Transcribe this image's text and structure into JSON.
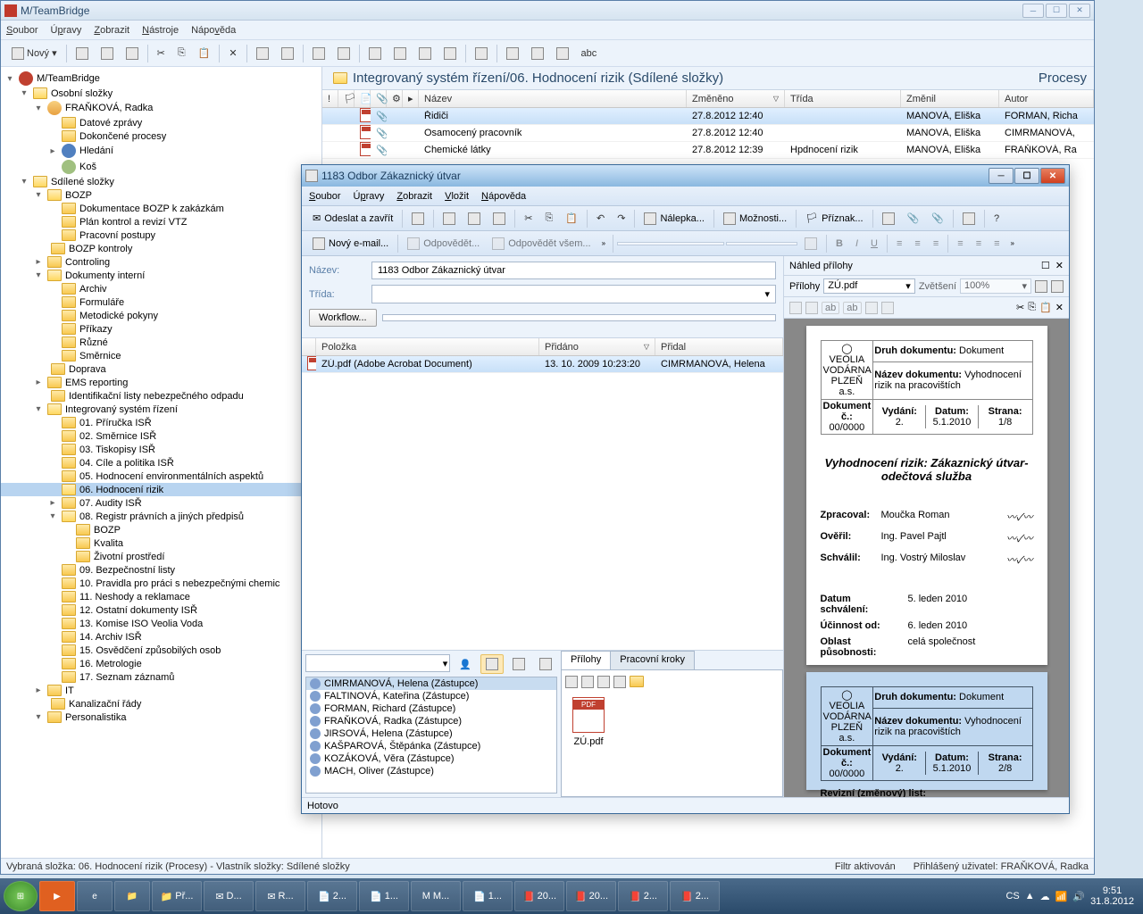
{
  "app": {
    "title": "M/TeamBridge"
  },
  "menubar": [
    "Soubor",
    "Úpravy",
    "Zobrazit",
    "Nástroje",
    "Nápověda"
  ],
  "toolbar": {
    "novy": "Nový"
  },
  "tree": {
    "root": "M/TeamBridge",
    "osobni": "Osobní složky",
    "user": "FRAŇKOVÁ, Radka",
    "datove": "Datové zprávy",
    "dokoncene": "Dokončené procesy",
    "hledani": "Hledání",
    "kos": "Koš",
    "sdilene": "Sdílené složky",
    "bozp": "BOZP",
    "dok_bozp": "Dokumentace BOZP k zakázkám",
    "plan": "Plán kontrol a revizí VTZ",
    "prac_postupy": "Pracovní postupy",
    "bozp_kontroly": "BOZP kontroly",
    "controling": "Controling",
    "dok_interni": "Dokumenty interní",
    "archiv": "Archiv",
    "formulare": "Formuláře",
    "metodicke": "Metodické pokyny",
    "prikazy": "Příkazy",
    "ruzne": "Různé",
    "smernice": "Směrnice",
    "doprava": "Doprava",
    "ems": "EMS reporting",
    "ident_listy": "Identifikační listy nebezpečného odpadu",
    "isr": "Integrovaný systém řízení",
    "i01": "01. Příručka ISŘ",
    "i02": "02. Směrnice ISŘ",
    "i03": "03. Tiskopisy ISŘ",
    "i04": "04. Cíle a politika ISŘ",
    "i05": "05. Hodnocení environmentálních aspektů",
    "i06": "06. Hodnocení rizik",
    "i07": "07. Audity ISŘ",
    "i08": "08. Registr právních a jiných předpisů",
    "i08_bozp": "BOZP",
    "i08_kvalita": "Kvalita",
    "i08_zivotni": "Životní prostředí",
    "i09": "09. Bezpečnostní listy",
    "i10": "10. Pravidla pro práci s nebezpečnými chemic",
    "i11": "11. Neshody a reklamace",
    "i12": "12. Ostatní dokumenty ISŘ",
    "i13": "13. Komise ISO Veolia Voda",
    "i14": "14. Archiv ISŘ",
    "i15": "15. Osvědčení způsobilých osob",
    "i16": "16. Metrologie",
    "i17": "17. Seznam záznamů",
    "it": "IT",
    "kanal": "Kanalizační řády",
    "personal": "Personalistika"
  },
  "breadcrumb": {
    "path": "Integrovaný systém řízení/06. Hodnocení rizik (Sdílené složky)",
    "right": "Procesy"
  },
  "grid": {
    "cols": {
      "nazev": "Název",
      "zmeneno": "Změněno",
      "trida": "Třída",
      "zmenil": "Změnil",
      "autor": "Autor"
    },
    "rows": [
      {
        "nazev": "Řidiči",
        "zmeneno": "27.8.2012 12:40",
        "trida": "",
        "zmenil": "MANOVÁ, Eliška",
        "autor": "FORMAN, Richa"
      },
      {
        "nazev": "Osamocený pracovník",
        "zmeneno": "27.8.2012 12:40",
        "trida": "",
        "zmenil": "MANOVÁ, Eliška",
        "autor": "CIMRMANOVÁ,"
      },
      {
        "nazev": "Chemické látky",
        "zmeneno": "27.8.2012 12:39",
        "trida": "Hpdnocení rizik",
        "zmenil": "MANOVÁ, Eliška",
        "autor": "FRAŇKOVÁ, Ra"
      }
    ]
  },
  "inner": {
    "title": "1183 Odbor Zákaznický útvar",
    "menubar": [
      "Soubor",
      "Úpravy",
      "Zobrazit",
      "Vložit",
      "Nápověda"
    ],
    "tb": {
      "odeslat": "Odeslat a zavřít",
      "nalepka": "Nálepka...",
      "moznosti": "Možnosti...",
      "priznak": "Příznak..."
    },
    "tb2": {
      "novy_email": "Nový e-mail...",
      "odpovedet": "Odpovědět...",
      "odpovedet_vsem": "Odpovědět všem..."
    },
    "form": {
      "nazev_lbl": "Název:",
      "nazev_val": "1183 Odbor Zákaznický útvar",
      "trida_lbl": "Třída:",
      "workflow": "Workflow..."
    },
    "items": {
      "cols": {
        "polozka": "Položka",
        "pridano": "Přidáno",
        "pridal": "Přidal"
      },
      "row": {
        "polozka": "ZÚ.pdf (Adobe Acrobat Document)",
        "pridano": "13. 10. 2009 10:23:20",
        "pridal": "CIMRMANOVÁ, Helena"
      }
    },
    "assignees": [
      "CIMRMANOVÁ, Helena (Zástupce)",
      "FALTINOVÁ, Kateřina (Zástupce)",
      "FORMAN, Richard (Zástupce)",
      "FRAŇKOVÁ, Radka (Zástupce)",
      "JIRSOVÁ, Helena (Zástupce)",
      "KAŠPAROVÁ, Štěpánka (Zástupce)",
      "KOZÁKOVÁ, Věra (Zástupce)",
      "MACH, Oliver (Zástupce)"
    ],
    "tabs": {
      "prilohy": "Přílohy",
      "prac_kroky": "Pracovní kroky"
    },
    "attach_name": "ZÚ.pdf",
    "preview": {
      "header": "Náhled přílohy",
      "prilohy_lbl": "Přílohy",
      "file": "ZÚ.pdf",
      "zvetseni_lbl": "Zvětšení",
      "zoom": "100%",
      "doc_title": "Vyhodnocení rizik: Zákaznický útvar- odečtová služba",
      "row1_lbl": "Druh dokumentu:",
      "row1_val": "Dokument",
      "row2_lbl": "Název dokumentu:",
      "row2_val": "Vyhodnocení rizik na pracovištích",
      "h_dok": "Dokument č.:",
      "h_dok_v": "00/0000",
      "h_vyd": "Vydání:",
      "h_vyd_v": "2.",
      "h_dat": "Datum:",
      "h_dat_v": "5.1.2010",
      "h_str": "Strana:",
      "h_str_v": "1/8",
      "h_str2_v": "2/8",
      "sp_zprac": "Zpracoval:",
      "sp_zprac_v": "Moučka Roman",
      "sp_over": "Ověřil:",
      "sp_over_v": "Ing. Pavel Pajtl",
      "sp_schv": "Schválil:",
      "sp_schv_v": "Ing. Vostrý Miloslav",
      "dat_schv": "Datum schválení:",
      "dat_schv_v": "5. leden 2010",
      "ucin": "Účinnost od:",
      "ucin_v": "6. leden 2010",
      "obl": "Oblast působnosti:",
      "obl_v": "celá společnost",
      "rev": "Revizní (změnový) list:"
    },
    "status": "Hotovo"
  },
  "status": {
    "left": "Vybraná složka: 06. Hodnocení rizik (Procesy)  -  Vlastník složky: Sdílené složky",
    "filtr": "Filtr aktivován",
    "user": "Přihlášený uživatel: FRAŇKOVÁ, Radka"
  },
  "taskbar": {
    "items": [
      "Př...",
      "D...",
      "R...",
      "2...",
      "1...",
      "M...",
      "1...",
      "20...",
      "20...",
      "2...",
      "2..."
    ],
    "lang": "CS",
    "time": "9:51",
    "date": "31.8.2012"
  }
}
